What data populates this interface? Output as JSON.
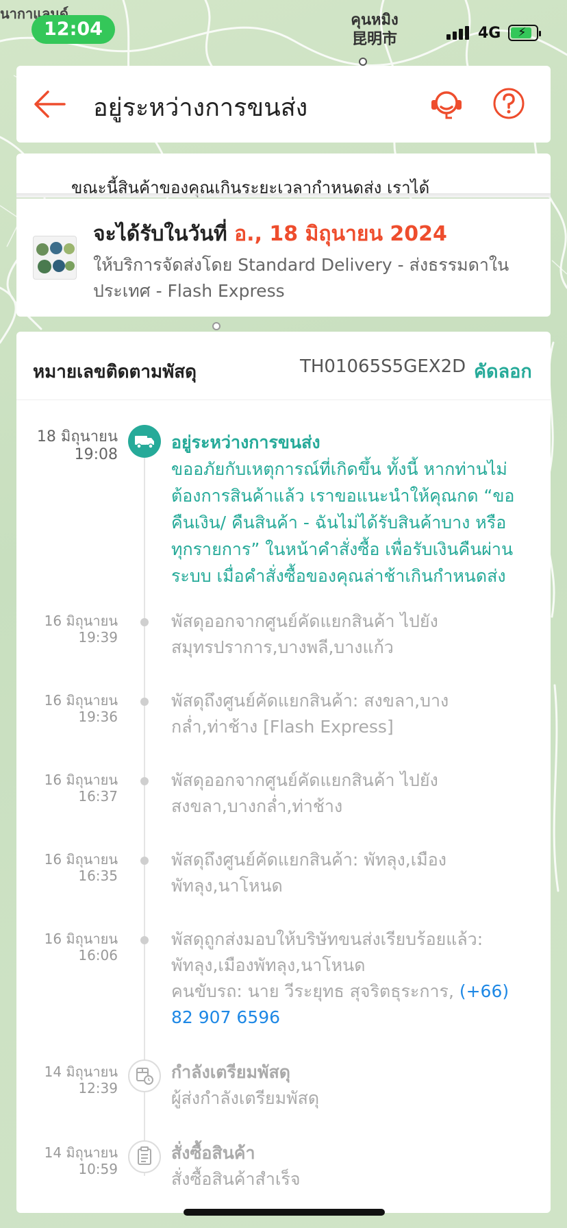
{
  "status_bar": {
    "time": "12:04",
    "network": "4G",
    "map_city_thai": "คุนหมิง",
    "map_city_cn": "昆明市",
    "map_label_left": "นากาแลนด์"
  },
  "header": {
    "title": "อยู่ระหว่างการขนส่ง",
    "back_icon": "arrow-left-icon",
    "support_icon": "headset-icon",
    "help_icon": "question-icon"
  },
  "notice": {
    "text": "ขณะนี้สินค้าของคุณเกินระยะเวลากำหนดส่ง เราได้"
  },
  "delivery": {
    "label": "จะได้รับในวันที่",
    "date": "อ., 18 มิถุนายน 2024",
    "service_line1": "ให้บริการจัดส่งโดย Standard Delivery - ส่งธรรมดาใน",
    "service_line2": "ประเทศ - Flash Express"
  },
  "tracking": {
    "label": "หมายเลขติดตามพัสดุ",
    "number": "TH01065S5GEX2D",
    "copy_label": "คัดลอก"
  },
  "events": [
    {
      "date": "18 มิถุนายน",
      "time": "19:08",
      "title": "อยู่ระหว่างการขนส่ง",
      "lines": [
        "ขออภัยกับเหตุการณ์ที่เกิดขึ้น ทั้งนี้ หากท่านไม่",
        "ต้องการสินค้าแล้ว เราขอแนะนำให้คุณกด “ขอ",
        "คืนเงิน/ คืนสินค้า - ฉันไม่ได้รับสินค้าบาง หรือ",
        "ทุกรายการ” ในหน้าคำสั่งซื้อ เพื่อรับเงินคืนผ่าน",
        "ระบบ เมื่อคำสั่งซื้อของคุณล่าช้าเกินกำหนดส่ง"
      ]
    },
    {
      "date": "16 มิถุนายน",
      "time": "19:39",
      "lines": [
        "พัสดุออกจากศูนย์คัดแยกสินค้า ไปยัง",
        "สมุทรปราการ,บางพลี,บางแก้ว"
      ]
    },
    {
      "date": "16 มิถุนายน",
      "time": "19:36",
      "lines": [
        "พัสดุถึงศูนย์คัดแยกสินค้า: สงขลา,บาง",
        "กล่ำ,ท่าช้าง  [Flash Express]"
      ]
    },
    {
      "date": "16 มิถุนายน",
      "time": "16:37",
      "lines": [
        "พัสดุออกจากศูนย์คัดแยกสินค้า ไปยัง",
        "สงขลา,บางกล่ำ,ท่าช้าง"
      ]
    },
    {
      "date": "16 มิถุนายน",
      "time": "16:35",
      "lines": [
        "พัสดุถึงศูนย์คัดแยกสินค้า: พัทลุง,เมือง",
        "พัทลุง,นาโหนด"
      ]
    },
    {
      "date": "16 มิถุนายน",
      "time": "16:06",
      "lines": [
        "พัสดุถูกส่งมอบให้บริษัทขนส่งเรียบร้อยแล้ว:",
        "พัทลุง,เมืองพัทลุง,นาโหนด"
      ],
      "driver_prefix": "คนขับรถ: นาย วีระยุทธ สุจริตธุระการ,",
      "phone_part1": "(+66)",
      "phone_part2": "82 907 6596"
    },
    {
      "date": "14 มิถุนายน",
      "time": "12:39",
      "title": "กำลังเตรียมพัสดุ",
      "lines": [
        " ผู้ส่งกำลังเตรียมพัสดุ"
      ],
      "icon": "package-clock-icon"
    },
    {
      "date": "14 มิถุนายน",
      "time": "10:59",
      "title": "สั่งซื้อสินค้า",
      "lines": [
        "สั่งซื้อสินค้าสำเร็จ"
      ],
      "icon": "clipboard-icon"
    }
  ],
  "colors": {
    "brand_orange": "#ee4d2d",
    "teal": "#26aa99",
    "link_blue": "#1e88e5",
    "status_green": "#34c759"
  }
}
